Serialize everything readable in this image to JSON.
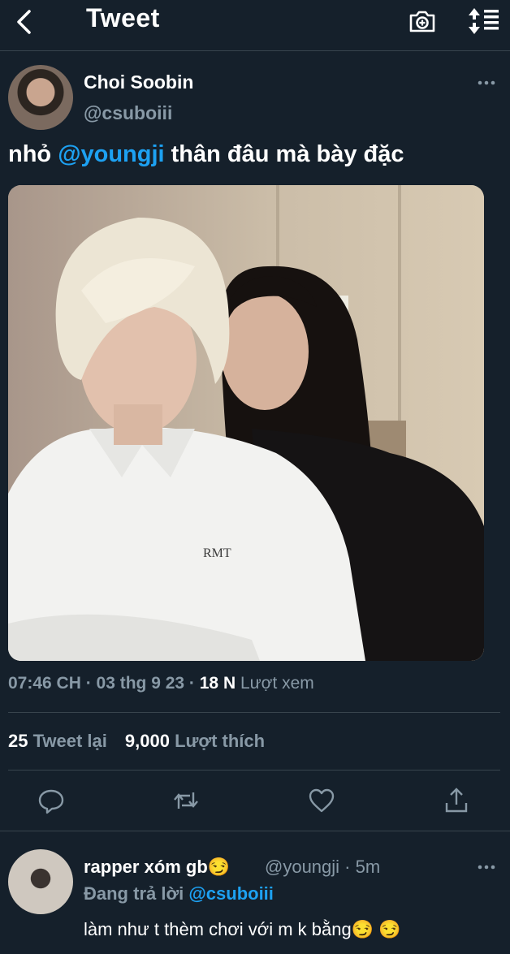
{
  "header": {
    "title": "Tweet",
    "icons": [
      "back-arrow-icon",
      "camera-plus-icon",
      "sort-icon"
    ]
  },
  "tweet": {
    "author_name": "Choi Soobin",
    "author_handle": "@csuboiii",
    "text_before": "nhỏ ",
    "text_mention": "@youngji",
    "text_after": " thân đâu mà bày đặc",
    "time_date": "07:46 CH · 03 thg 9 23 · ",
    "views_count": "18 N",
    "views_label": " Lượt xem",
    "retweets_count": "25",
    "retweets_label": " Tweet lại",
    "likes_count": "9,000",
    "likes_label": " Lượt thích",
    "actions": [
      "reply-icon",
      "retweet-icon",
      "like-icon",
      "share-icon"
    ]
  },
  "reply": {
    "author_name": "rapper xóm gb😏",
    "author_handle": "@youngji · 5m",
    "replying_prefix": "Đang trả lời ",
    "replying_to": "@csuboiii",
    "text": "làm như t thèm chơi với m k bằng😏 😏"
  },
  "colors": {
    "background": "#15202b",
    "accent": "#1da1f2",
    "muted": "#8899a6",
    "divider": "#38444d"
  }
}
